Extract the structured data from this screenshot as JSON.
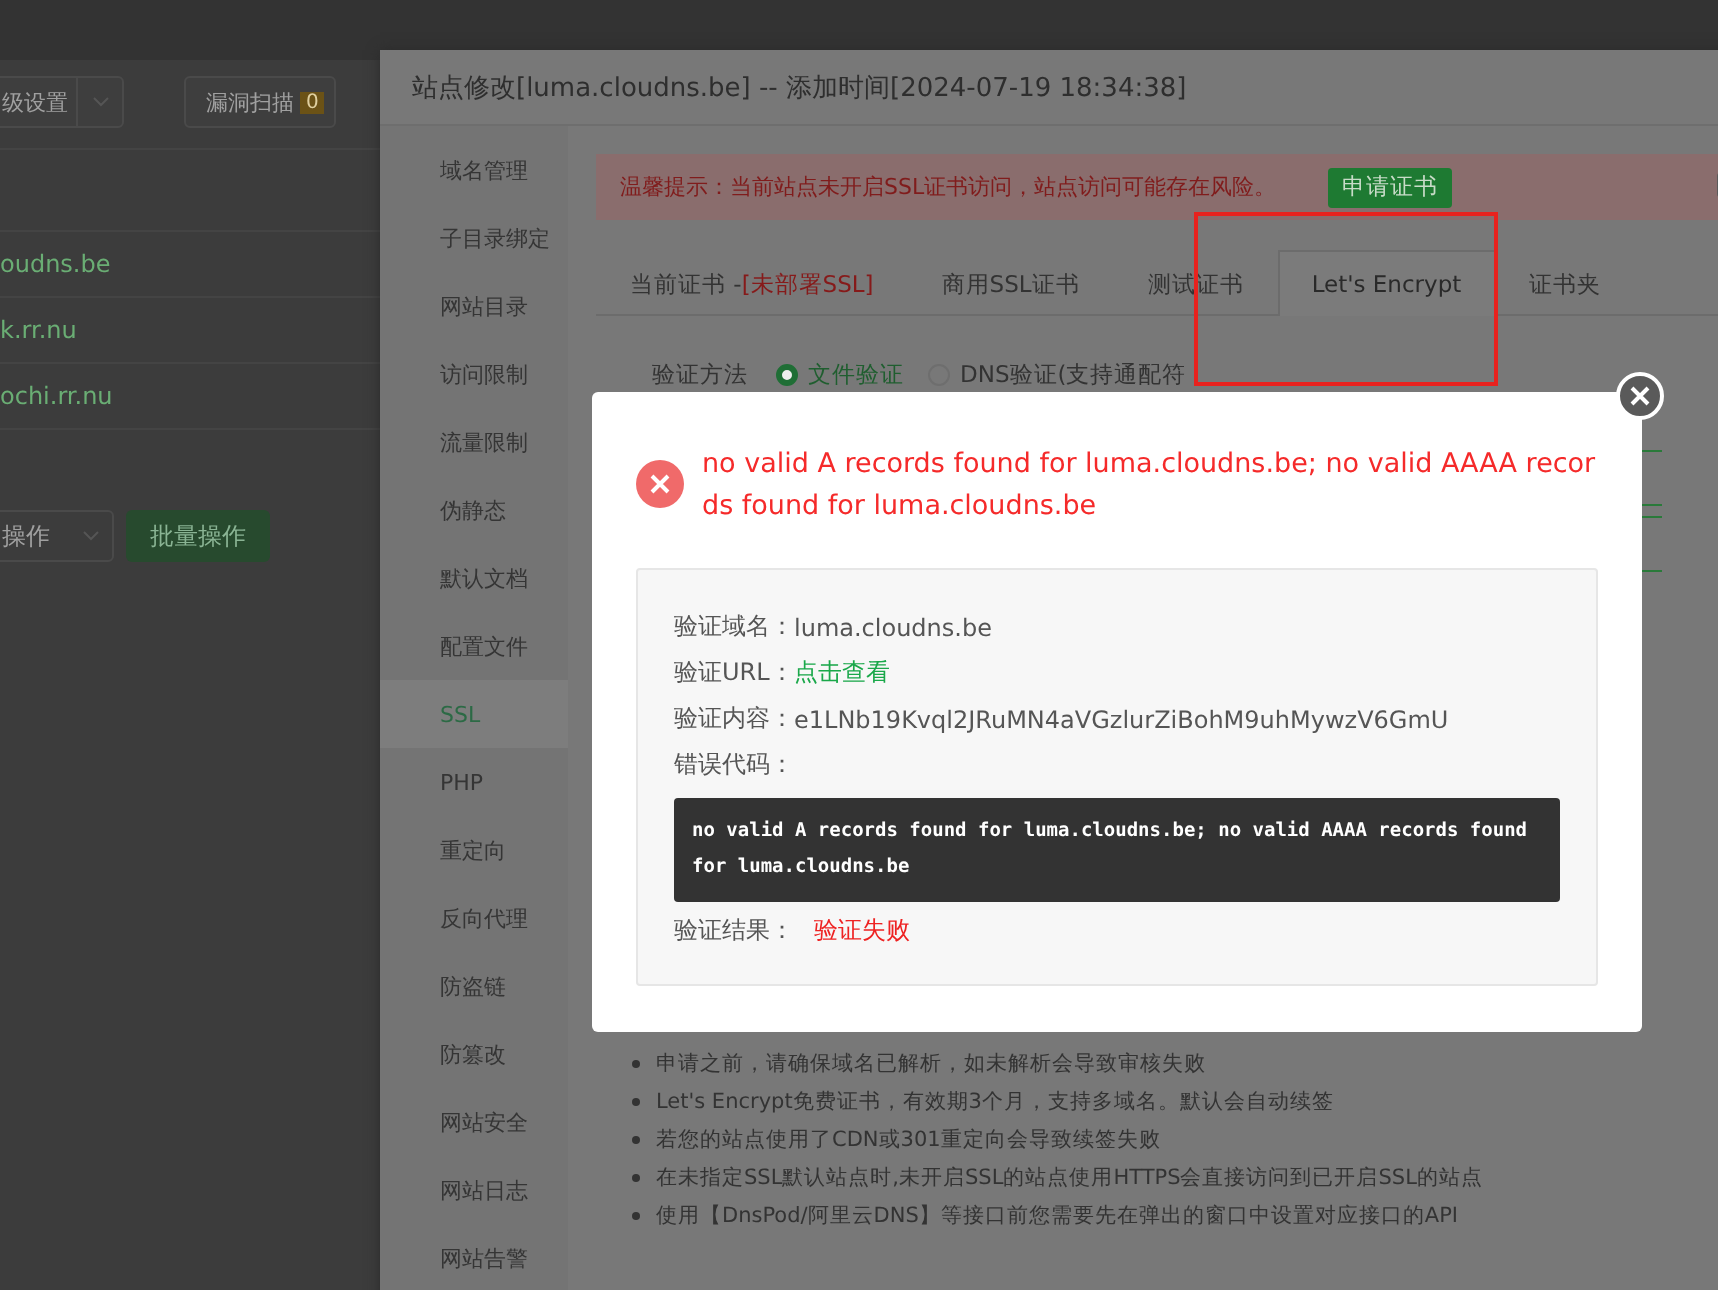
{
  "background": {
    "dropdown": "级设置",
    "scan_button": {
      "label": "漏洞扫描",
      "badge": "0"
    },
    "sites": [
      "oudns.be",
      "k.rr.nu",
      "ochi.rr.nu"
    ],
    "batch_select": "操作",
    "batch_button": "批量操作"
  },
  "window": {
    "title": "站点修改[luma.cloudns.be] -- 添加时间[2024-07-19 18:34:38]"
  },
  "sidebar": {
    "items": [
      {
        "label": "域名管理",
        "selected": false
      },
      {
        "label": "子目录绑定",
        "selected": false
      },
      {
        "label": "网站目录",
        "selected": false
      },
      {
        "label": "访问限制",
        "selected": false
      },
      {
        "label": "流量限制",
        "selected": false
      },
      {
        "label": "伪静态",
        "selected": false
      },
      {
        "label": "默认文档",
        "selected": false
      },
      {
        "label": "配置文件",
        "selected": false
      },
      {
        "label": "SSL",
        "selected": true
      },
      {
        "label": "PHP",
        "selected": false
      },
      {
        "label": "重定向",
        "selected": false
      },
      {
        "label": "反向代理",
        "selected": false
      },
      {
        "label": "防盗链",
        "selected": false
      },
      {
        "label": "防篡改",
        "selected": false
      },
      {
        "label": "网站安全",
        "selected": false
      },
      {
        "label": "网站日志",
        "selected": false
      },
      {
        "label": "网站告警",
        "selected": false
      }
    ]
  },
  "alert": {
    "text": "温馨提示：当前站点未开启SSL证书访问，站点访问可能存在风险。",
    "button": "申请证书"
  },
  "tabs": [
    {
      "label": "当前证书 -",
      "status": "[未部署SSL]",
      "selected": false
    },
    {
      "label": "商用SSL证书",
      "selected": false
    },
    {
      "label": "测试证书",
      "selected": false
    },
    {
      "label": "Let's Encrypt",
      "selected": true
    },
    {
      "label": "证书夹",
      "selected": false
    }
  ],
  "verify_method": {
    "label": "验证方法",
    "options": [
      {
        "label": "文件验证",
        "selected": true
      },
      {
        "label": "DNS验证(支持通配符",
        "selected": false
      }
    ]
  },
  "notes": [
    "申请之前，请确保域名已解析，如未解析会导致审核失败",
    "Let's Encrypt免费证书，有效期3个月，支持多域名。默认会自动续签",
    "若您的站点使用了CDN或301重定向会导致续签失败",
    "在未指定SSL默认站点时,未开启SSL的站点使用HTTPS会直接访问到已开启SSL的站点",
    "使用【DnsPod/阿里云DNS】等接口前您需要先在弹出的窗口中设置对应接口的API"
  ],
  "dialog": {
    "message": "no valid A records found for luma.cloudns.be; no valid AAAA records found for luma.cloudns.be",
    "fields": [
      {
        "kind": "text",
        "label": "验证域名：",
        "value": "luma.cloudns.be"
      },
      {
        "kind": "link",
        "label": "验证URL：",
        "value": "点击查看"
      },
      {
        "kind": "text",
        "label": "验证内容：",
        "value": "e1LNb19Kvql2JRuMN4aVGzlurZiBohM9uhMywzV6GmU"
      },
      {
        "kind": "code",
        "label": "错误代码：",
        "value": "no valid A records found for luma.cloudns.be; no valid AAAA records found for luma.cloudns.be"
      },
      {
        "kind": "error",
        "label": "验证结果：",
        "value": "验证失败"
      }
    ]
  }
}
